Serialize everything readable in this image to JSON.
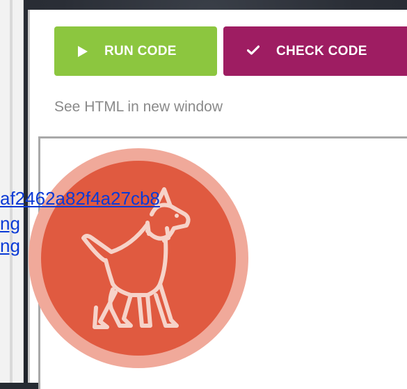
{
  "toolbar": {
    "run_label": "RUN CODE",
    "check_label": "CHECK CODE",
    "run_icon": "play-icon",
    "check_icon": "checkmark-icon",
    "run_color": "#8cc63f",
    "check_color": "#9e1d62"
  },
  "preview": {
    "see_link": "See HTML in new window",
    "badge_icon": "dog-icon",
    "badge_color": "#e05a40"
  },
  "output_links": [
    "af2462a82f4a27cb8",
    "ng",
    "ng"
  ]
}
